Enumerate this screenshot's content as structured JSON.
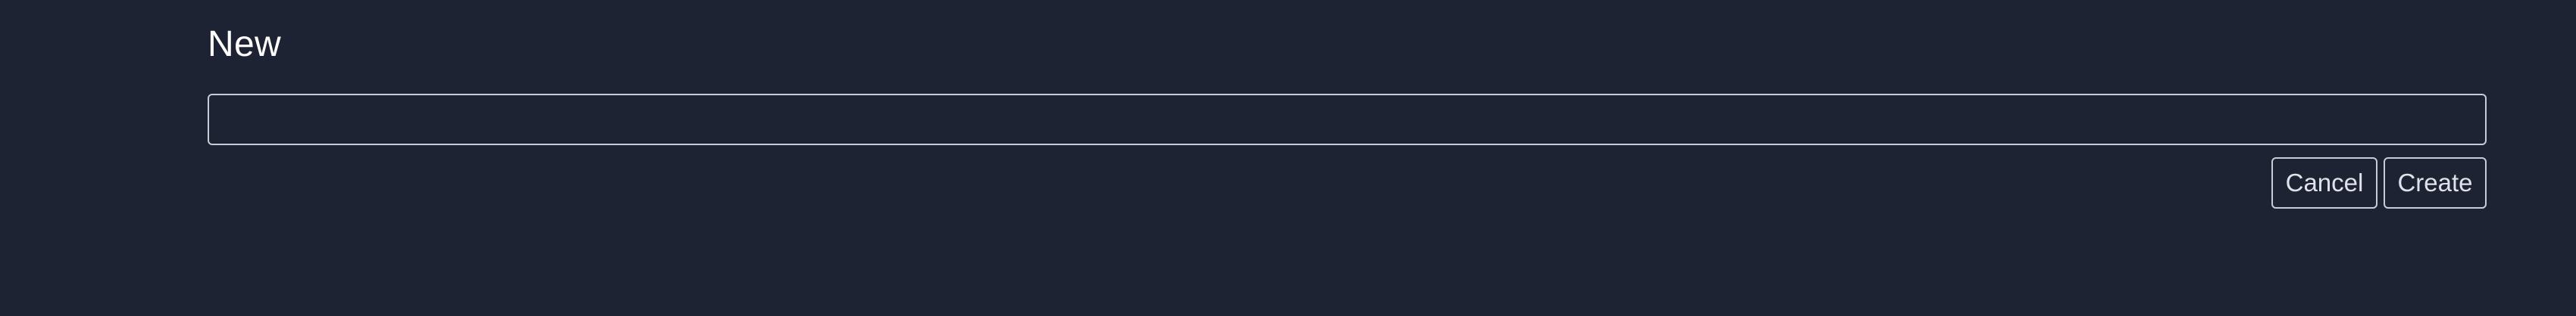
{
  "dialog": {
    "title": "New",
    "name_input": {
      "value": "",
      "placeholder": ""
    },
    "cancel_label": "Cancel",
    "create_label": "Create"
  },
  "colors": {
    "background": "#1e2333",
    "border": "#c9ccd6",
    "text": "#ffffff"
  }
}
